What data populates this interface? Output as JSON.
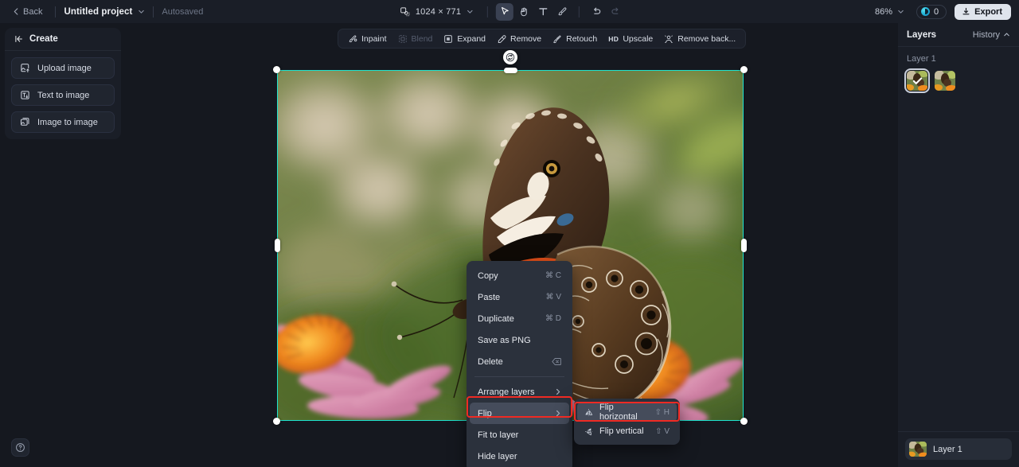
{
  "topbar": {
    "back_label": "Back",
    "project_name": "Untitled project",
    "autosaved_label": "Autosaved",
    "canvas_size": "1024 × 771",
    "tools": [
      {
        "name": "select-tool",
        "icon": "cursor-arrow-icon",
        "active": true
      },
      {
        "name": "hand-tool",
        "icon": "hand-icon",
        "active": false
      },
      {
        "name": "text-tool",
        "icon": "text-t-icon",
        "active": false
      },
      {
        "name": "brush-tool",
        "icon": "brush-icon",
        "active": false
      }
    ],
    "undo_label": "Undo",
    "redo_label": "Redo",
    "zoom_level": "86%",
    "credits": "0",
    "export_label": "Export"
  },
  "left_panel": {
    "title": "Create",
    "items": [
      {
        "label": "Upload image",
        "icon": "upload-image-icon"
      },
      {
        "label": "Text to image",
        "icon": "text-to-image-icon"
      },
      {
        "label": "Image to image",
        "icon": "image-to-image-icon"
      }
    ],
    "help_label": "Help"
  },
  "edit_toolbar": {
    "items": [
      {
        "label": "Inpaint",
        "icon": "inpaint-icon",
        "disabled": false
      },
      {
        "label": "Blend",
        "icon": "blend-icon",
        "disabled": true
      },
      {
        "label": "Expand",
        "icon": "expand-icon",
        "disabled": false
      },
      {
        "label": "Remove",
        "icon": "remove-icon",
        "disabled": false
      },
      {
        "label": "Retouch",
        "icon": "retouch-icon",
        "disabled": false
      },
      {
        "label": "Upscale",
        "icon": "hd-icon",
        "badge": "HD",
        "disabled": false
      },
      {
        "label": "Remove back...",
        "icon": "remove-background-icon",
        "disabled": false
      }
    ]
  },
  "canvas": {
    "selection_color": "#1ee3cf",
    "rotate_handle": "rotate-icon",
    "artwork_alt": "Butterfly resting on pink and orange coneflowers with green bokeh background"
  },
  "context_menu": {
    "items": [
      {
        "label": "Copy",
        "shortcut": "⌘ C",
        "type": "item"
      },
      {
        "label": "Paste",
        "shortcut": "⌘ V",
        "type": "item"
      },
      {
        "label": "Duplicate",
        "shortcut": "⌘ D",
        "type": "item"
      },
      {
        "label": "Save as PNG",
        "shortcut": "",
        "type": "item"
      },
      {
        "label": "Delete",
        "shortcut": "⌫",
        "type": "item"
      },
      {
        "type": "separator"
      },
      {
        "label": "Arrange layers",
        "shortcut": "",
        "type": "submenu"
      },
      {
        "label": "Flip",
        "shortcut": "",
        "type": "submenu",
        "highlight": true
      },
      {
        "label": "Fit to layer",
        "shortcut": "",
        "type": "item"
      },
      {
        "label": "Hide layer",
        "shortcut": "",
        "type": "item"
      }
    ]
  },
  "sub_menu": {
    "items": [
      {
        "label": "Flip horizontal",
        "shortcut": "⇧ H",
        "icon": "flip-horizontal-icon",
        "highlight": true
      },
      {
        "label": "Flip vertical",
        "shortcut": "⇧ V",
        "icon": "flip-vertical-icon",
        "highlight": false
      }
    ]
  },
  "right_panel": {
    "title": "Layers",
    "history_label": "History",
    "layer_group": "Layer 1",
    "layer_row_name": "Layer 1",
    "thumbnails": [
      {
        "name": "history-thumb-1",
        "selected": true
      },
      {
        "name": "history-thumb-2",
        "selected": false
      }
    ]
  },
  "annotations": {
    "highlight_color": "#ef2a23"
  }
}
